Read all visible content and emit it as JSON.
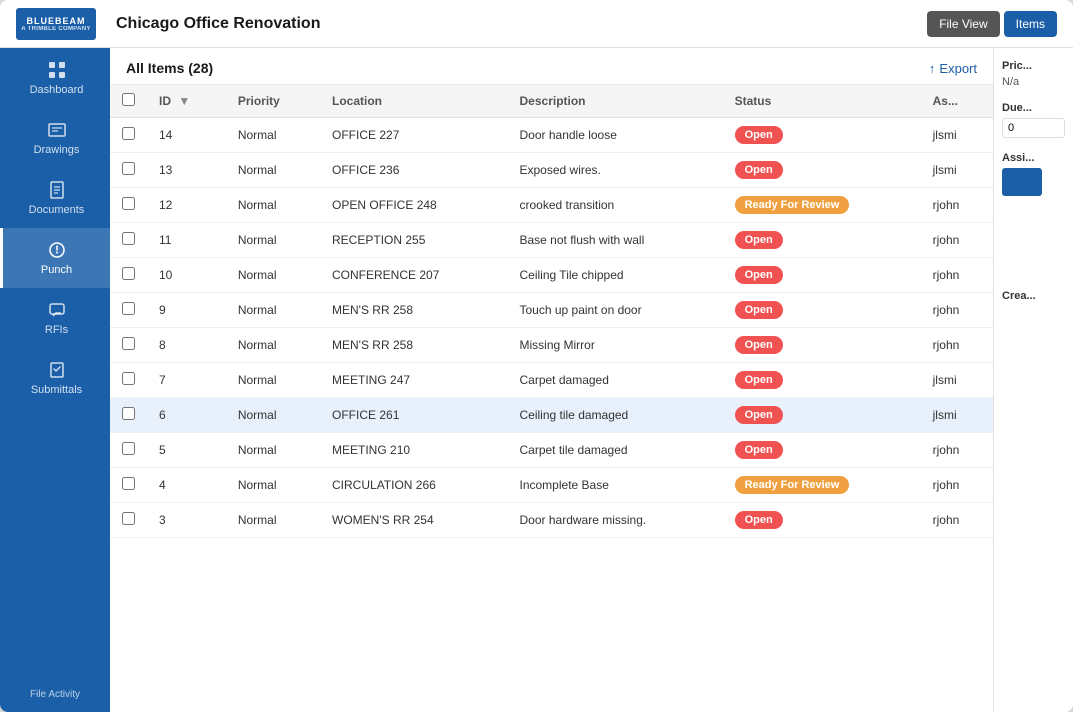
{
  "window": {
    "title": "Chicago Office Renovation"
  },
  "header": {
    "title": "Chicago Office Renovation",
    "file_view_btn": "File View",
    "items_btn": "Items"
  },
  "sidebar": {
    "items": [
      {
        "id": "dashboard",
        "label": "Dashboard",
        "icon": "grid"
      },
      {
        "id": "drawings",
        "label": "Drawings",
        "icon": "map"
      },
      {
        "id": "documents",
        "label": "Documents",
        "icon": "file"
      },
      {
        "id": "punch",
        "label": "Punch",
        "icon": "tool",
        "active": true
      },
      {
        "id": "rfis",
        "label": "RFIs",
        "icon": "message"
      },
      {
        "id": "submittals",
        "label": "Submittals",
        "icon": "clipboard"
      }
    ],
    "bottom_label": "File Activity"
  },
  "content": {
    "items_count_label": "All Items (28)",
    "export_label": "Export"
  },
  "table": {
    "columns": [
      "",
      "ID",
      "Priority",
      "Location",
      "Description",
      "Status",
      "Assigned"
    ],
    "rows": [
      {
        "id": "14",
        "priority": "Normal",
        "location": "OFFICE 227",
        "description": "Door handle loose",
        "status": "Open",
        "assigned": "jlsmi",
        "highlighted": false
      },
      {
        "id": "13",
        "priority": "Normal",
        "location": "OFFICE 236",
        "description": "Exposed wires.",
        "status": "Open",
        "assigned": "jlsmi",
        "highlighted": false
      },
      {
        "id": "12",
        "priority": "Normal",
        "location": "OPEN OFFICE 248",
        "description": "crooked transition",
        "status": "Ready For Review",
        "assigned": "rjohn",
        "highlighted": false
      },
      {
        "id": "11",
        "priority": "Normal",
        "location": "RECEPTION 255",
        "description": "Base not flush with wall",
        "status": "Open",
        "assigned": "rjohn",
        "highlighted": false
      },
      {
        "id": "10",
        "priority": "Normal",
        "location": "CONFERENCE 207",
        "description": "Ceiling Tile chipped",
        "status": "Open",
        "assigned": "rjohn",
        "highlighted": false
      },
      {
        "id": "9",
        "priority": "Normal",
        "location": "MEN'S RR 258",
        "description": "Touch up paint on door",
        "status": "Open",
        "assigned": "rjohn",
        "highlighted": false
      },
      {
        "id": "8",
        "priority": "Normal",
        "location": "MEN'S RR 258",
        "description": "Missing Mirror",
        "status": "Open",
        "assigned": "rjohn",
        "highlighted": false
      },
      {
        "id": "7",
        "priority": "Normal",
        "location": "MEETING 247",
        "description": "Carpet damaged",
        "status": "Open",
        "assigned": "jlsmi",
        "highlighted": false
      },
      {
        "id": "6",
        "priority": "Normal",
        "location": "OFFICE 261",
        "description": "Ceiling tile damaged",
        "status": "Open",
        "assigned": "jlsmi",
        "highlighted": true
      },
      {
        "id": "5",
        "priority": "Normal",
        "location": "MEETING 210",
        "description": "Carpet tile damaged",
        "status": "Open",
        "assigned": "rjohn",
        "highlighted": false
      },
      {
        "id": "4",
        "priority": "Normal",
        "location": "CIRCULATION 266",
        "description": "Incomplete Base",
        "status": "Ready For Review",
        "assigned": "rjohn",
        "highlighted": false
      },
      {
        "id": "3",
        "priority": "Normal",
        "location": "WOMEN'S RR 254",
        "description": "Door hardware missing.",
        "status": "Open",
        "assigned": "rjohn",
        "highlighted": false
      }
    ]
  },
  "right_panel": {
    "price_label": "Price",
    "price_value": "N/a",
    "due_label": "Due",
    "due_value": "0",
    "assigned_label": "Assigned",
    "created_label": "Created"
  },
  "icons": {
    "grid": "⊞",
    "map": "🗺",
    "file": "📄",
    "tool": "🔧",
    "message": "✉",
    "clipboard": "📋",
    "export": "↑",
    "sort": "▼"
  }
}
